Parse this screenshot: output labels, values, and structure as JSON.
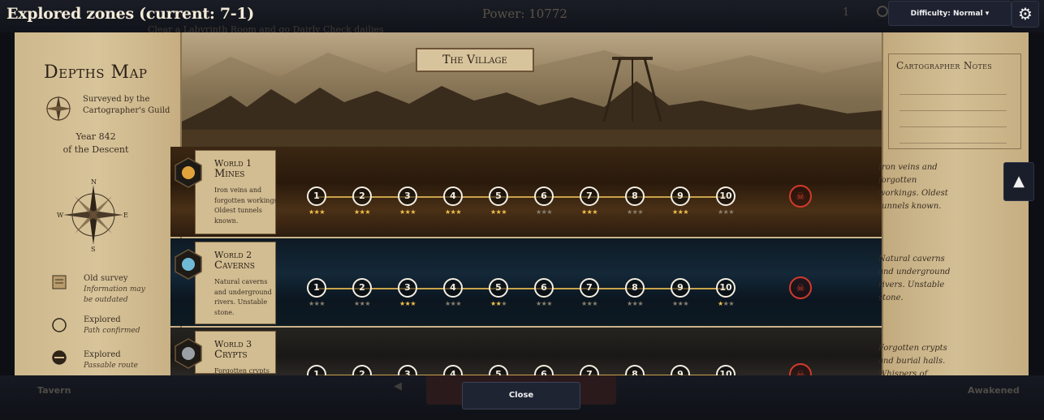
{
  "header": {
    "title": "Explored zones (current: 7-1)",
    "power_label": "Power: 10772",
    "subtitle": "Clear a Labyrinth Room and go Dairly  Check dailies",
    "counter": "1",
    "difficulty_label": "Difficulty: Normal ▾",
    "settings_icon": "gear-icon"
  },
  "map": {
    "left_panel": {
      "title": "Depths Map",
      "guild_line1": "Surveyed by the",
      "guild_line2": "Cartographer's Guild",
      "year_line1": "Year 842",
      "year_line2": "of the Descent",
      "compass": {
        "n": "N",
        "s": "S",
        "e": "E",
        "w": "W"
      },
      "legend": [
        {
          "label": "Old survey",
          "desc1": "Information may",
          "desc2": "be outdated"
        },
        {
          "label": "Explored",
          "desc1": "Path confirmed",
          "desc2": ""
        },
        {
          "label": "Explored",
          "desc1": "Passable route",
          "desc2": ""
        }
      ]
    },
    "village_title": "The Village",
    "notes_title": "Cartographer Notes",
    "worlds": [
      {
        "num": "World 1",
        "name": "Mines",
        "desc": "Iron veins and forgotten workings. Oldest tunnels known.",
        "note": "Iron veins and forgotten workings. Oldest tunnels known.",
        "levels": [
          "1",
          "2",
          "3",
          "4",
          "5",
          "6",
          "7",
          "8",
          "9",
          "10"
        ],
        "stars": [
          3,
          3,
          3,
          3,
          3,
          0,
          3,
          0,
          3,
          0
        ],
        "accent": "#e2a33c"
      },
      {
        "num": "World 2",
        "name": "Caverns",
        "desc": "Natural caverns and underground rivers. Unstable stone.",
        "note": "Natural caverns and underground rivers. Unstable stone.",
        "levels": [
          "1",
          "2",
          "3",
          "4",
          "5",
          "6",
          "7",
          "8",
          "9",
          "10"
        ],
        "stars": [
          0,
          0,
          3,
          0,
          2,
          0,
          0,
          0,
          0,
          1
        ],
        "accent": "#6fb9d6"
      },
      {
        "num": "World 3",
        "name": "Crypts",
        "desc": "Forgotten crypts",
        "note": "Forgotten crypts and burial halls. Whispers of",
        "levels": [
          "1",
          "2",
          "3",
          "4",
          "5",
          "6",
          "7",
          "8",
          "9",
          "10"
        ],
        "stars": [
          0,
          0,
          0,
          0,
          0,
          0,
          0,
          0,
          0,
          0
        ],
        "accent": "#9aa0a6"
      }
    ]
  },
  "nav": {
    "tavern": "Tavern",
    "awakened": "Awakened",
    "close_label": "Close",
    "up_arrow": "▲"
  }
}
